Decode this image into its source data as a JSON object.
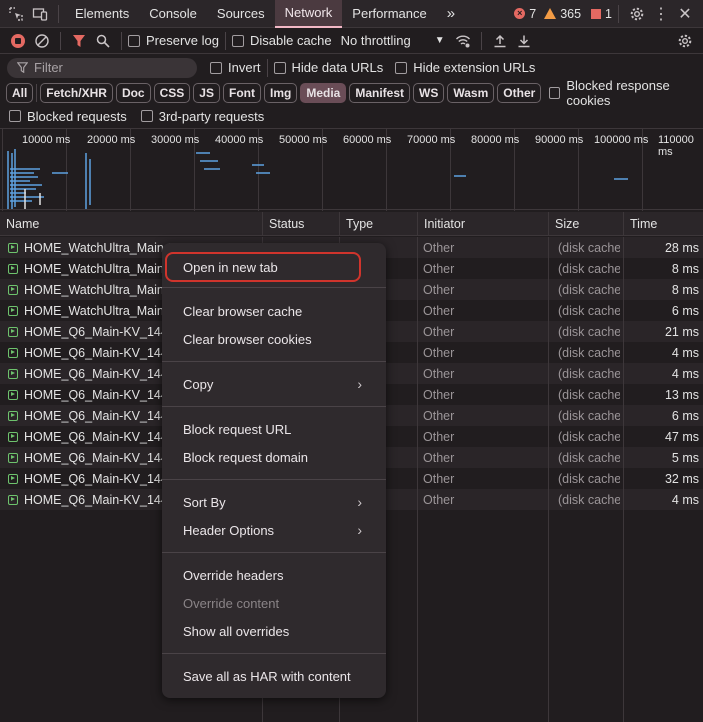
{
  "tabs": [
    "Elements",
    "Console",
    "Sources",
    "Network",
    "Performance"
  ],
  "active_tab": "Network",
  "more_tabs": "»",
  "counts": {
    "errors": "7",
    "warnings": "365",
    "issues": "1"
  },
  "toolbar": {
    "preserve_log": "Preserve log",
    "disable_cache": "Disable cache",
    "throttling": "No throttling"
  },
  "filter": {
    "placeholder": "Filter",
    "invert": "Invert",
    "hide_data_urls": "Hide data URLs",
    "hide_extension_urls": "Hide extension URLs"
  },
  "type_filters": [
    "All",
    "Fetch/XHR",
    "Doc",
    "CSS",
    "JS",
    "Font",
    "Img",
    "Media",
    "Manifest",
    "WS",
    "Wasm",
    "Other"
  ],
  "active_type": "Media",
  "blocked_response_cookies": "Blocked response cookies",
  "blocked_requests": "Blocked requests",
  "third_party_requests": "3rd-party requests",
  "overview_ticks": [
    "10000 ms",
    "20000 ms",
    "30000 ms",
    "40000 ms",
    "50000 ms",
    "60000 ms",
    "70000 ms",
    "80000 ms",
    "90000 ms",
    "100000 ms",
    "110000 ms"
  ],
  "table": {
    "headers": {
      "name": "Name",
      "status": "Status",
      "type": "Type",
      "initiator": "Initiator",
      "size": "Size",
      "time": "Time"
    },
    "rows": [
      {
        "name": "HOME_WatchUltra_Main-K",
        "initiator": "Other",
        "size": "(disk cache)",
        "time": "28 ms"
      },
      {
        "name": "HOME_WatchUltra_Main-K",
        "initiator": "Other",
        "size": "(disk cache)",
        "time": "8 ms"
      },
      {
        "name": "HOME_WatchUltra_Main-K",
        "initiator": "Other",
        "size": "(disk cache)",
        "time": "8 ms"
      },
      {
        "name": "HOME_WatchUltra_Main-K",
        "initiator": "Other",
        "size": "(disk cache)",
        "time": "6 ms"
      },
      {
        "name": "HOME_Q6_Main-KV_1440:",
        "initiator": "Other",
        "size": "(disk cache)",
        "time": "21 ms"
      },
      {
        "name": "HOME_Q6_Main-KV_1440:",
        "initiator": "Other",
        "size": "(disk cache)",
        "time": "4 ms"
      },
      {
        "name": "HOME_Q6_Main-KV_1440:",
        "initiator": "Other",
        "size": "(disk cache)",
        "time": "4 ms"
      },
      {
        "name": "HOME_Q6_Main-KV_1440:",
        "initiator": "Other",
        "size": "(disk cache)",
        "time": "13 ms"
      },
      {
        "name": "HOME_Q6_Main-KV_1440:",
        "initiator": "Other",
        "size": "(disk cache)",
        "time": "6 ms"
      },
      {
        "name": "HOME_Q6_Main-KV_1440:",
        "initiator": "Other",
        "size": "(disk cache)",
        "time": "47 ms"
      },
      {
        "name": "HOME_Q6_Main-KV_1440:",
        "initiator": "Other",
        "size": "(disk cache)",
        "time": "5 ms"
      },
      {
        "name": "HOME_Q6_Main-KV_1440:",
        "initiator": "Other",
        "size": "(disk cache)",
        "time": "32 ms"
      },
      {
        "name": "HOME_Q6_Main-KV_1440:",
        "initiator": "Other",
        "size": "(disk cache)",
        "time": "4 ms"
      }
    ]
  },
  "context_menu": {
    "open_new_tab": "Open in new tab",
    "clear_cache": "Clear browser cache",
    "clear_cookies": "Clear browser cookies",
    "copy": "Copy",
    "block_url": "Block request URL",
    "block_domain": "Block request domain",
    "sort_by": "Sort By",
    "header_options": "Header Options",
    "override_headers": "Override headers",
    "override_content": "Override content",
    "show_overrides": "Show all overrides",
    "save_har": "Save all as HAR with content",
    "submenu_arrow": "›"
  }
}
